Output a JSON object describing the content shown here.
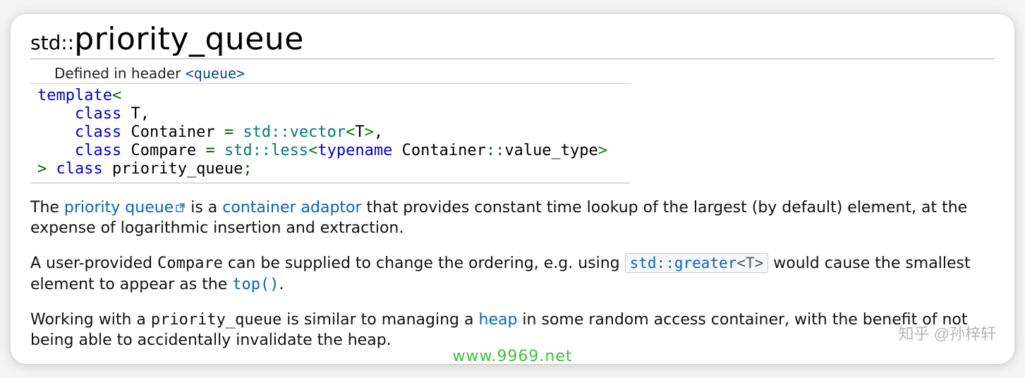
{
  "title": {
    "namespace": "std::",
    "name": "priority_queue"
  },
  "defined": {
    "prefix": "Defined in header ",
    "header": "<queue>"
  },
  "decl": {
    "l1a": "template",
    "l1b": "<",
    "l2a": "    class",
    "l2b": " T,",
    "l3a": "    class",
    "l3b": " Container ",
    "l3c": "=",
    "l3d": " std::",
    "l3e": "vector",
    "l3f": "<",
    "l3g": "T",
    "l3h": ">",
    "l3i": ",",
    "l4a": "    class",
    "l4b": " Compare ",
    "l4c": "=",
    "l4d": " std::",
    "l4e": "less",
    "l4f": "<",
    "l4g": "typename",
    "l4h": " Container",
    "l4i": "::",
    "l4j": "value_type",
    "l4k": ">",
    "l5a": ">",
    "l5b": " class",
    "l5c": " priority_queue",
    "l5d": ";"
  },
  "p1": {
    "s1": "The ",
    "link1": "priority queue",
    "s2": " is a ",
    "link2": "container adaptor",
    "s3": " that provides constant time lookup of the largest (by default) element, at the expense of logarithmic insertion and extraction."
  },
  "p2": {
    "s1": "A user-provided ",
    "compare": "Compare",
    "s2": " can be supplied to change the ordering, e.g. using ",
    "code_std": "std::greater",
    "code_tpl": "<T>",
    "s3": " would cause the smallest element to appear as the ",
    "top": "top()",
    "s4": "."
  },
  "p3": {
    "s1": "Working with a ",
    "pq": "priority_queue",
    "s2": " is similar to managing a ",
    "heap": "heap",
    "s3": " in some random access container, with the benefit of not being able to accidentally invalidate the heap."
  },
  "watermarks": {
    "right": "知乎 @孙梓轩",
    "center": "www.9969.net"
  }
}
